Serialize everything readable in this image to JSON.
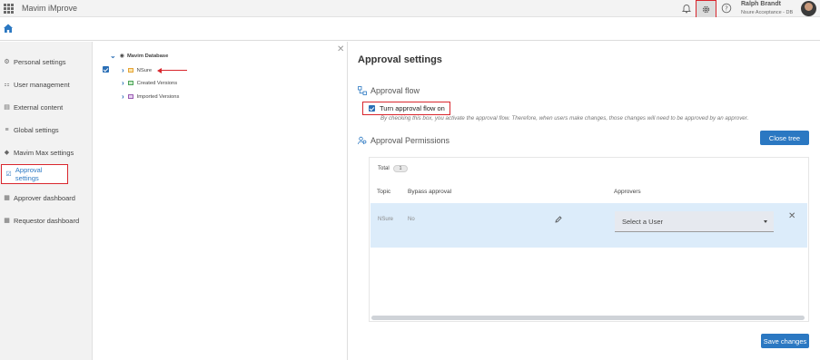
{
  "app": {
    "title": "Mavim iMprove"
  },
  "user": {
    "name": "Ralph Brandt",
    "subtitle": "Nsure Acceptance - DB"
  },
  "sidebar": {
    "items": [
      {
        "label": "Personal settings",
        "icon": "person-icon"
      },
      {
        "label": "User management",
        "icon": "users-icon"
      },
      {
        "label": "External content",
        "icon": "content-icon"
      },
      {
        "label": "Global settings",
        "icon": "sliders-icon"
      },
      {
        "label": "Mavim Max settings",
        "icon": "max-icon"
      },
      {
        "label": "Approval settings",
        "icon": "approval-icon",
        "active": true
      },
      {
        "label": "Approver dashboard",
        "icon": "dashboard-icon"
      },
      {
        "label": "Requestor dashboard",
        "icon": "dashboard-icon"
      }
    ]
  },
  "tree": {
    "root": "Mavim Database",
    "children": [
      "NSure",
      "Created Versions",
      "Imported Versions"
    ]
  },
  "main": {
    "title": "Approval settings",
    "approval_flow": {
      "title": "Approval flow",
      "toggle_label": "Turn approval flow on",
      "checked": true,
      "description": "By checking this box, you activate the approval flow. Therefore, when users make changes, those changes will need to be approved by an approver."
    },
    "permissions": {
      "title": "Approval Permissions",
      "close_tree_label": "Close tree",
      "total_label": "Total",
      "total_count": "1",
      "columns": {
        "topic": "Topic",
        "bypass": "Bypass approval",
        "approvers": "Approvers"
      },
      "rows": [
        {
          "topic": "NSure",
          "bypass": "No",
          "approver_placeholder": "Select a User"
        }
      ]
    },
    "save_label": "Save changes"
  },
  "colors": {
    "accent": "#2b78c2",
    "highlight": "#d9262d",
    "row_bg": "#dcecfa"
  }
}
